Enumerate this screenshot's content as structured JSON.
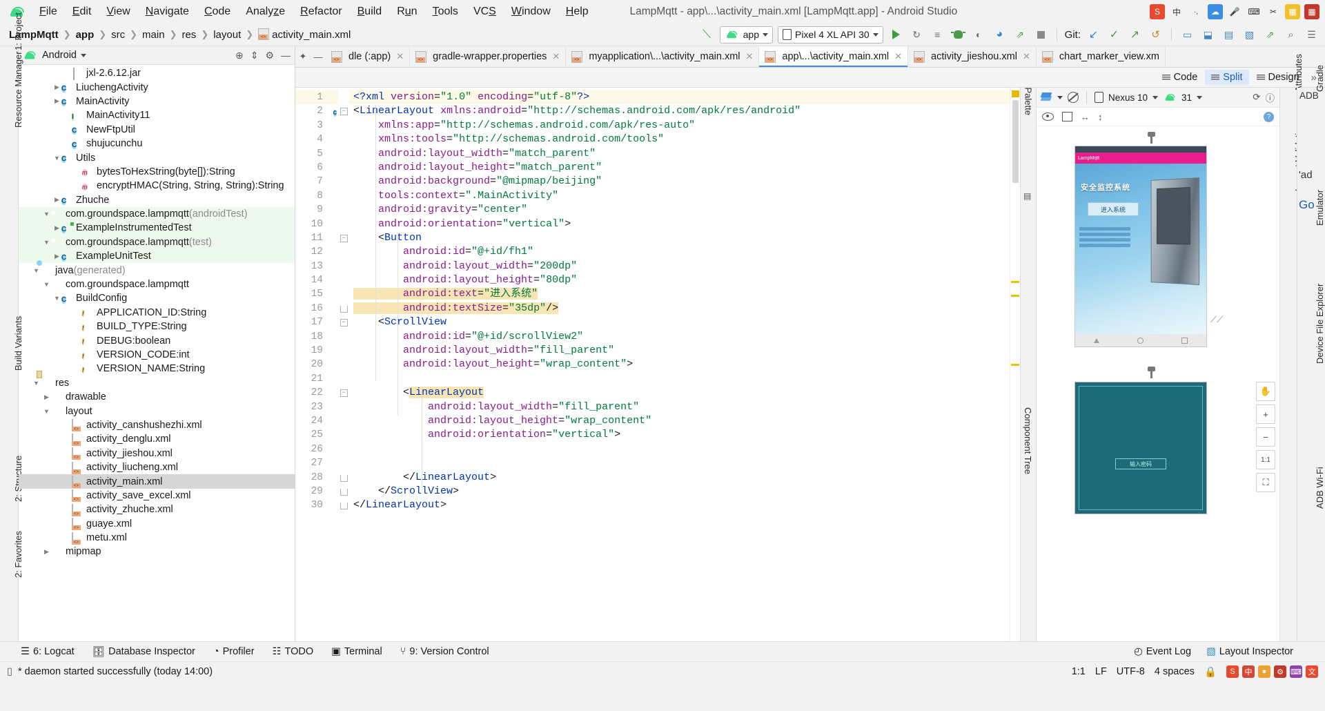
{
  "window": {
    "title": "LampMqtt - app\\...\\activity_main.xml [LampMqtt.app] - Android Studio"
  },
  "menubar": {
    "logo_icon": "android-logo-icon",
    "items": [
      "File",
      "Edit",
      "View",
      "Navigate",
      "Code",
      "Analyze",
      "Refactor",
      "Build",
      "Run",
      "Tools",
      "VCS",
      "Window",
      "Help"
    ]
  },
  "system_tray": [
    {
      "name": "sogou-icon",
      "glyph": "S",
      "color": "#e8492f"
    },
    {
      "name": "ime-chinese-icon",
      "glyph": "中",
      "color": "#f2f2f2"
    },
    {
      "name": "ime-punct-icon",
      "glyph": "·,",
      "color": "#f2f2f2"
    },
    {
      "name": "ime-cloud-icon",
      "glyph": "●",
      "color": "#3a8ee6"
    },
    {
      "name": "mic-icon",
      "glyph": "⚙",
      "color": "#f2f2f2"
    },
    {
      "name": "keyboard-icon",
      "glyph": "⌨",
      "color": "#f2f2f2"
    },
    {
      "name": "screenshot-icon",
      "glyph": "✂",
      "color": "#f2f2f2"
    },
    {
      "name": "toolbox-icon",
      "glyph": "■",
      "color": "#f2c12e"
    },
    {
      "name": "apps-grid-icon",
      "glyph": "▦",
      "color": "#c0392b"
    }
  ],
  "breadcrumb": {
    "items": [
      "LampMqtt",
      "app",
      "src",
      "main",
      "res",
      "layout"
    ],
    "file": "activity_main.xml",
    "file_icon": "xml-file-icon"
  },
  "toolbar": {
    "build_icon": "build-hammer-icon",
    "run_config": "app",
    "run_config_icon": "android-config-icon",
    "device": "Pixel 4 XL API 30",
    "device_icon": "device-icon",
    "actions": [
      {
        "name": "run-button",
        "glyph": "▶"
      },
      {
        "name": "apply-changes-button",
        "glyph": "↺"
      },
      {
        "name": "apply-code-changes-button",
        "glyph": "≡"
      },
      {
        "name": "debug-button",
        "glyph": "⬟"
      },
      {
        "name": "attach-debugger-button",
        "glyph": "◑"
      },
      {
        "name": "profiler-button",
        "glyph": "◔"
      },
      {
        "name": "run-gradle-button",
        "glyph": "↗"
      },
      {
        "name": "stop-button",
        "glyph": "■"
      }
    ],
    "git_label": "Git:",
    "git_actions": [
      {
        "name": "git-update-button",
        "glyph": "↙"
      },
      {
        "name": "git-commit-button",
        "glyph": "✓"
      },
      {
        "name": "git-push-button",
        "glyph": "↗"
      },
      {
        "name": "git-history-button",
        "glyph": "↺"
      }
    ],
    "right_actions": [
      {
        "name": "avd-manager-button",
        "glyph": "▭"
      },
      {
        "name": "sdk-manager-button",
        "glyph": "⬒"
      },
      {
        "name": "device-explorer-button",
        "glyph": "▤"
      },
      {
        "name": "layout-inspector-button",
        "glyph": "▧"
      },
      {
        "name": "profiler-open-button",
        "glyph": "↗"
      },
      {
        "name": "search-everywhere-button",
        "glyph": "⚲"
      },
      {
        "name": "settings-button",
        "glyph": "☰"
      }
    ]
  },
  "left_rail": [
    "1: Project",
    "Resource Manager",
    "Build Variants",
    "2: Structure",
    "2: Favorites"
  ],
  "right_rail": [
    "Gradle",
    "Attributes",
    "Layout Validation",
    "Emulator",
    "Device File Explorer",
    "ADB Wi-Fi"
  ],
  "project_panel": {
    "header": "Android",
    "header_icon": "android-logo-icon",
    "actions": [
      {
        "name": "select-opened-file-icon",
        "glyph": "⊕"
      },
      {
        "name": "collapse-all-icon",
        "glyph": "⤓"
      },
      {
        "name": "settings-gear-icon",
        "glyph": "⚙"
      },
      {
        "name": "hide-panel-icon",
        "glyph": "−"
      }
    ],
    "tree": [
      {
        "indent": 4,
        "arrow": "",
        "icon": "jar",
        "label": "jxl-2.6.12.jar"
      },
      {
        "indent": 3,
        "arrow": "right",
        "icon": "class",
        "label": "LiuchengActivity"
      },
      {
        "indent": 3,
        "arrow": "right",
        "icon": "class",
        "label": "MainActivity"
      },
      {
        "indent": 4,
        "arrow": "",
        "icon": "interface",
        "label": "MainActivity11"
      },
      {
        "indent": 4,
        "arrow": "",
        "icon": "class",
        "label": "NewFtpUtil"
      },
      {
        "indent": 4,
        "arrow": "",
        "icon": "class",
        "label": "shujucunchu"
      },
      {
        "indent": 3,
        "arrow": "down",
        "icon": "class",
        "label": "Utils"
      },
      {
        "indent": 5,
        "arrow": "",
        "icon": "method",
        "label": "bytesToHexString(byte[]):String"
      },
      {
        "indent": 5,
        "arrow": "",
        "icon": "method",
        "label": "encryptHMAC(String, String, String):String"
      },
      {
        "indent": 3,
        "arrow": "right",
        "icon": "class",
        "label": "Zhuche"
      },
      {
        "indent": 2,
        "arrow": "down",
        "icon": "package",
        "label": "com.groundspace.lampmqtt",
        "suffix": "(androidTest)",
        "green": true
      },
      {
        "indent": 3,
        "arrow": "right",
        "icon": "class-test",
        "label": "ExampleInstrumentedTest",
        "green": true
      },
      {
        "indent": 2,
        "arrow": "down",
        "icon": "package",
        "label": "com.groundspace.lampmqtt",
        "suffix": "(test)",
        "green": true
      },
      {
        "indent": 3,
        "arrow": "right",
        "icon": "class",
        "label": "ExampleUnitTest",
        "green": true
      },
      {
        "indent": 1,
        "arrow": "down",
        "icon": "folder-generated",
        "label": "java",
        "suffix": "(generated)"
      },
      {
        "indent": 2,
        "arrow": "down",
        "icon": "package",
        "label": "com.groundspace.lampmqtt"
      },
      {
        "indent": 3,
        "arrow": "down",
        "icon": "class-gen",
        "label": "BuildConfig"
      },
      {
        "indent": 5,
        "arrow": "",
        "icon": "field",
        "label": "APPLICATION_ID:String"
      },
      {
        "indent": 5,
        "arrow": "",
        "icon": "field",
        "label": "BUILD_TYPE:String"
      },
      {
        "indent": 5,
        "arrow": "",
        "icon": "field",
        "label": "DEBUG:boolean"
      },
      {
        "indent": 5,
        "arrow": "",
        "icon": "field",
        "label": "VERSION_CODE:int"
      },
      {
        "indent": 5,
        "arrow": "",
        "icon": "field",
        "label": "VERSION_NAME:String"
      },
      {
        "indent": 1,
        "arrow": "down",
        "icon": "folder-res",
        "label": "res"
      },
      {
        "indent": 2,
        "arrow": "right",
        "icon": "package",
        "label": "drawable"
      },
      {
        "indent": 2,
        "arrow": "down",
        "icon": "package",
        "label": "layout"
      },
      {
        "indent": 4,
        "arrow": "",
        "icon": "xml",
        "label": "activity_canshushezhi.xml"
      },
      {
        "indent": 4,
        "arrow": "",
        "icon": "xml",
        "label": "activity_denglu.xml"
      },
      {
        "indent": 4,
        "arrow": "",
        "icon": "xml",
        "label": "activity_jieshou.xml"
      },
      {
        "indent": 4,
        "arrow": "",
        "icon": "xml",
        "label": "activity_liucheng.xml"
      },
      {
        "indent": 4,
        "arrow": "",
        "icon": "xml",
        "label": "activity_main.xml",
        "selected": true
      },
      {
        "indent": 4,
        "arrow": "",
        "icon": "xml",
        "label": "activity_save_excel.xml"
      },
      {
        "indent": 4,
        "arrow": "",
        "icon": "xml",
        "label": "activity_zhuche.xml"
      },
      {
        "indent": 4,
        "arrow": "",
        "icon": "xml",
        "label": "guaye.xml"
      },
      {
        "indent": 4,
        "arrow": "",
        "icon": "xml",
        "label": "metu.xml"
      },
      {
        "indent": 2,
        "arrow": "right",
        "icon": "package",
        "label": "mipmap"
      }
    ]
  },
  "editor": {
    "tabs": [
      {
        "label": "dle (:app)",
        "icon": "gradle-icon",
        "active": false,
        "closable": true
      },
      {
        "label": "gradle-wrapper.properties",
        "icon": "properties-icon",
        "active": false,
        "closable": true
      },
      {
        "label": "myapplication\\...\\activity_main.xml",
        "icon": "xml-file-icon",
        "active": false,
        "closable": true
      },
      {
        "label": "app\\...\\activity_main.xml",
        "icon": "xml-file-icon",
        "active": true,
        "closable": true
      },
      {
        "label": "activity_jieshou.xml",
        "icon": "xml-file-icon",
        "active": false,
        "closable": true
      },
      {
        "label": "chart_marker_view.xm",
        "icon": "xml-file-icon",
        "active": false,
        "closable": false
      }
    ],
    "modes": [
      {
        "label": "Code",
        "icon": "code-icon",
        "active": false
      },
      {
        "label": "Split",
        "icon": "split-icon",
        "active": true
      },
      {
        "label": "Design",
        "icon": "design-icon",
        "active": false
      }
    ],
    "expand_glyph": "»",
    "lines": [
      {
        "n": 1,
        "current": true,
        "text": "<?xml version=\"1.0\" encoding=\"utf-8\"?>"
      },
      {
        "n": 2,
        "gutter_icon": "class-marker",
        "fold": "collapse",
        "text": "<LinearLayout xmlns:android=\"http://schemas.android.com/apk/res/android\""
      },
      {
        "n": 3,
        "text": "    xmlns:app=\"http://schemas.android.com/apk/res-auto\""
      },
      {
        "n": 4,
        "text": "    xmlns:tools=\"http://schemas.android.com/tools\""
      },
      {
        "n": 5,
        "text": "    android:layout_width=\"match_parent\""
      },
      {
        "n": 6,
        "text": "    android:layout_height=\"match_parent\""
      },
      {
        "n": 7,
        "gutter_icon": "image-marker",
        "text": "    android:background=\"@mipmap/beijing\""
      },
      {
        "n": 8,
        "text": "    tools:context=\".MainActivity\""
      },
      {
        "n": 9,
        "text": "    android:gravity=\"center\""
      },
      {
        "n": 10,
        "text": "    android:orientation=\"vertical\">"
      },
      {
        "n": 11,
        "fold": "collapse",
        "text": "    <Button"
      },
      {
        "n": 12,
        "text": "        android:id=\"@+id/fh1\""
      },
      {
        "n": 13,
        "text": "        android:layout_width=\"200dp\""
      },
      {
        "n": 14,
        "text": "        android:layout_height=\"80dp\""
      },
      {
        "n": 15,
        "highlight": true,
        "text": "        android:text=\"进入系统\""
      },
      {
        "n": 16,
        "fold": "end",
        "highlight": true,
        "text": "        android:textSize=\"35dp\"/>"
      },
      {
        "n": 17,
        "fold": "collapse",
        "text": "    <ScrollView"
      },
      {
        "n": 18,
        "text": "        android:id=\"@+id/scrollView2\""
      },
      {
        "n": 19,
        "text": "        android:layout_width=\"fill_parent\""
      },
      {
        "n": 20,
        "text": "        android:layout_height=\"wrap_content\">"
      },
      {
        "n": 21,
        "text": ""
      },
      {
        "n": 22,
        "fold": "collapse",
        "highlight_token": "LinearLayout",
        "text": "        <LinearLayout"
      },
      {
        "n": 23,
        "text": "            android:layout_width=\"fill_parent\""
      },
      {
        "n": 24,
        "text": "            android:layout_height=\"wrap_content\""
      },
      {
        "n": 25,
        "text": "            android:orientation=\"vertical\">"
      },
      {
        "n": 26,
        "text": ""
      },
      {
        "n": 27,
        "text": ""
      },
      {
        "n": 28,
        "fold": "end",
        "text": "        </LinearLayout>"
      },
      {
        "n": 29,
        "fold": "end",
        "text": "    </ScrollView>"
      },
      {
        "n": 30,
        "fold": "end",
        "text": "</LinearLayout>"
      }
    ],
    "syntax_colors": {
      "tag": "#0033b3",
      "attribute": "#8b1a8b",
      "value": "#007a3d",
      "highlight_bg": "#f7e6b4",
      "current_line_bg": "#fcfae6"
    }
  },
  "preview": {
    "rail_label": "Palette",
    "tree_rail_label": "Component Tree",
    "toolbar": {
      "layers_icon": "layers-icon",
      "blueprint_icon": "blueprint-icon",
      "device_icon": "device-icon",
      "device": "Nexus 10",
      "api_icon": "android-icon",
      "api": "31",
      "orientation_icon": "orientation-icon",
      "info_icon": "info-icon"
    },
    "toolbar2": {
      "eye_icon": "eye-icon",
      "columns_icon": "columns-icon",
      "horizontal_icon": "horizontal-arrows-icon",
      "vertical_icon": "vertical-arrows-icon",
      "help_icon": "help-icon"
    },
    "device_frame_1": {
      "app_label": "LampMqtt",
      "title": "安全监控系统",
      "button": "进入系统"
    },
    "device_frame_2": {
      "field": "输入密码"
    },
    "zoom_controls": [
      {
        "name": "pan-tool-button",
        "glyph": "✋"
      },
      {
        "name": "zoom-in-button",
        "glyph": "+"
      },
      {
        "name": "zoom-out-button",
        "glyph": "−"
      },
      {
        "name": "zoom-actual-button",
        "glyph": "1:1"
      },
      {
        "name": "zoom-fit-button",
        "glyph": "⛶"
      }
    ],
    "floating_labels": [
      "'ad",
      "Go"
    ]
  },
  "bottom_tools": [
    {
      "label": "6: Logcat",
      "icon": "logcat-icon",
      "mnemonic": "6"
    },
    {
      "label": "Database Inspector",
      "icon": "database-icon"
    },
    {
      "label": "Profiler",
      "icon": "profiler-icon"
    },
    {
      "label": "TODO",
      "icon": "todo-icon"
    },
    {
      "label": "Terminal",
      "icon": "terminal-icon"
    },
    {
      "label": "9: Version Control",
      "icon": "vcs-icon",
      "mnemonic": "9"
    }
  ],
  "bottom_right_tools": [
    {
      "label": "Event Log",
      "icon": "event-log-icon"
    },
    {
      "label": "Layout Inspector",
      "icon": "layout-inspector-icon"
    }
  ],
  "statusbar": {
    "message_icon": "notification-icon",
    "message": "* daemon started successfully (today 14:00)",
    "caret": "1:1",
    "line_separator": "LF",
    "encoding": "UTF-8",
    "indent": "4 spaces",
    "lock_icon": "lock-icon",
    "ime_items": [
      {
        "name": "sogou-pinyin-icon",
        "glyph": "S",
        "color": "#e8492f"
      },
      {
        "name": "ime-chinese-icon",
        "glyph": "中",
        "color": "#d14836"
      },
      {
        "name": "ime-mode-icon",
        "glyph": "●",
        "color": "#f0a030"
      },
      {
        "name": "ime-tool-icon",
        "glyph": "⚙",
        "color": "#c0392b"
      },
      {
        "name": "ime-keyboard-icon",
        "glyph": "⌨",
        "color": "#8e44ad"
      },
      {
        "name": "ime-text-icon",
        "glyph": "文",
        "color": "#e8492f"
      }
    ]
  }
}
